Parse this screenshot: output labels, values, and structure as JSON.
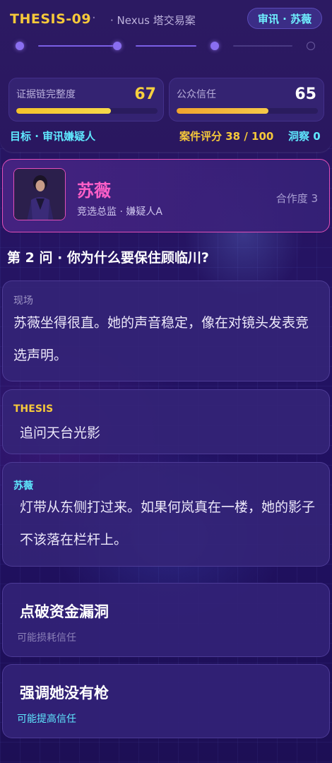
{
  "header": {
    "case_id": "THESIS-09",
    "separator": "·",
    "case_name": "· Nexus 塔交易案",
    "mode_chip": "审讯 · 苏薇",
    "progress": {
      "steps_total": 4,
      "steps_completed": 3
    }
  },
  "stats": {
    "evidence": {
      "label": "证据链完整度",
      "value": "67",
      "fraction": 0.67
    },
    "trust": {
      "label": "公众信任",
      "value": "65",
      "fraction": 0.65
    }
  },
  "status": {
    "goal": "目标 · 审讯嫌疑人",
    "score": "案件评分 38 / 100",
    "insight": "洞察 0"
  },
  "suspect": {
    "name": "苏薇",
    "role": "竞选总监 · 嫌疑人A",
    "cooperation": "合作度 3"
  },
  "question": "第 2 问 · 你为什么要保住顾临川?",
  "dialogue": [
    {
      "tag": "现场",
      "text": "苏薇坐得很直。她的声音稳定，像在对镜头发表竞选声明。"
    },
    {
      "tag": "THESIS",
      "text": "追问天台光影"
    },
    {
      "tag": "苏薇",
      "text": "灯带从东侧打过来。如果何岚真在一楼，她的影子不该落在栏杆上。"
    }
  ],
  "choices": [
    {
      "title": "点破资金漏洞",
      "hint": "可能损耗信任"
    },
    {
      "title": "强调她没有枪",
      "hint": "可能提高信任"
    }
  ],
  "colors": {
    "accent_yellow": "#f6c93a",
    "accent_cyan": "#5fe9ff",
    "accent_pink": "#ff5fc8",
    "bg": "#231263"
  }
}
